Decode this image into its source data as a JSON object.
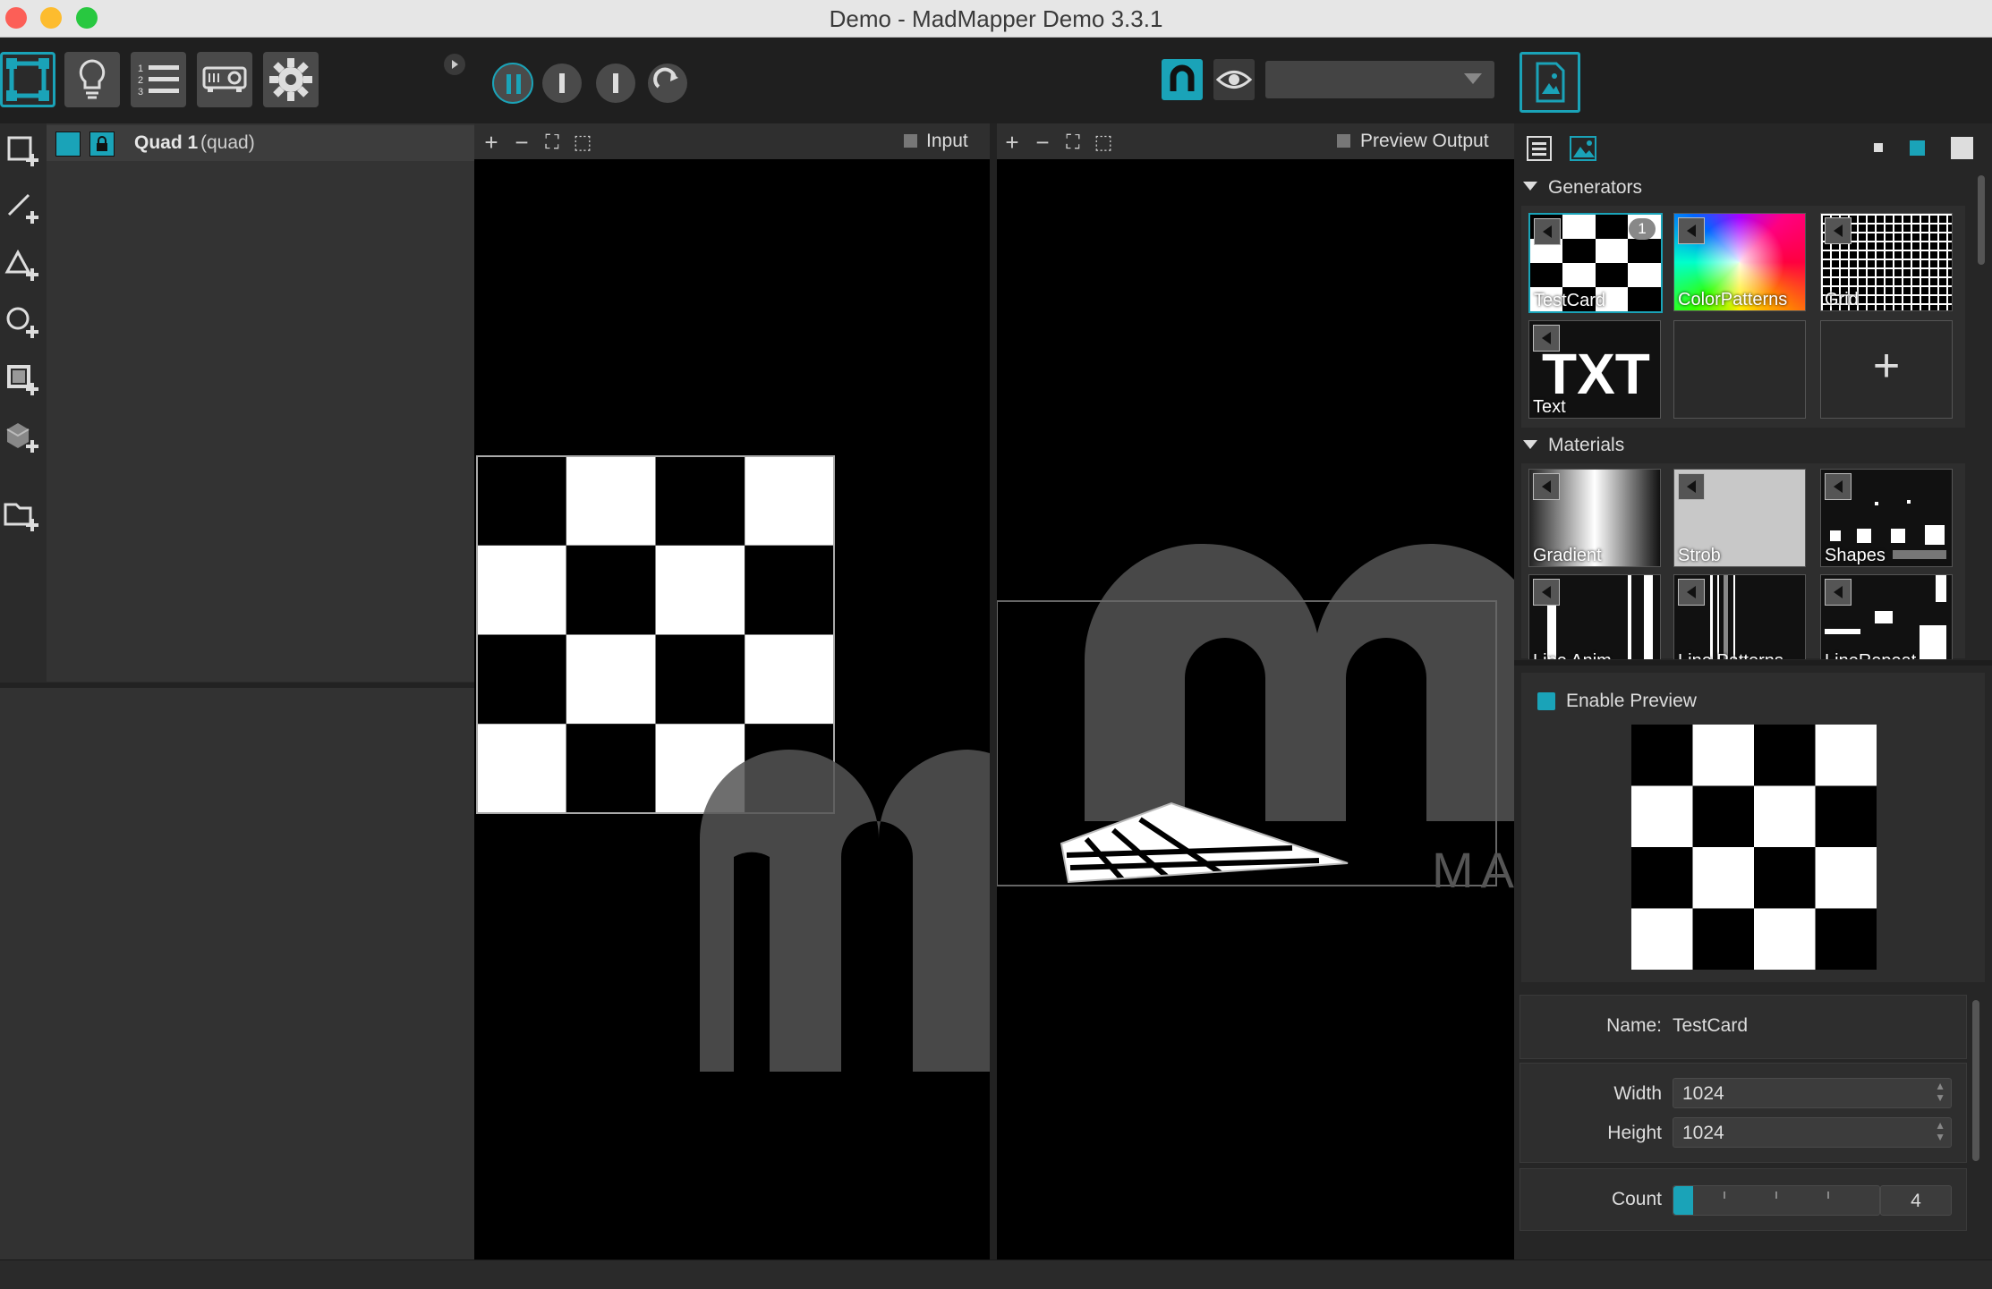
{
  "window": {
    "title": "Demo - MadMapper Demo 3.3.1"
  },
  "toolbar": {
    "left_buttons": [
      "surfaces-icon",
      "lightbulb-icon",
      "cue-list-icon",
      "projector-icon",
      "gear-icon"
    ],
    "transport": [
      "pause-icon",
      "stop-icon",
      "step-icon",
      "loop-icon"
    ],
    "output_selector_value": ""
  },
  "surfaces": {
    "items": [
      {
        "name": "Quad 1",
        "type": "(quad)"
      }
    ]
  },
  "input_view": {
    "label": "Input",
    "controls": [
      "+",
      "−",
      "⛶",
      "⬚"
    ]
  },
  "output_view": {
    "label": "Preview Output",
    "controls": [
      "+",
      "−",
      "⛶",
      "⬚"
    ],
    "watermark_text": "MA"
  },
  "library": {
    "generators_label": "Generators",
    "generators": [
      {
        "label": "TestCard",
        "badge": "1",
        "selected": true
      },
      {
        "label": "ColorPatterns"
      },
      {
        "label": "Grid"
      },
      {
        "label": "Text",
        "icon_text": "TXT"
      }
    ],
    "add_label": "+",
    "materials_label": "Materials",
    "materials": [
      {
        "label": "Gradient"
      },
      {
        "label": "Strob"
      },
      {
        "label": "Shapes"
      },
      {
        "label": "Line Anim"
      },
      {
        "label": "Line Patterns"
      },
      {
        "label": "LineRepeat"
      }
    ]
  },
  "preview": {
    "enable_label": "Enable Preview"
  },
  "properties": {
    "name_label": "Name:",
    "name_value": "TestCard",
    "width_label": "Width",
    "width_value": "1024",
    "height_label": "Height",
    "height_value": "1024",
    "count_label": "Count",
    "count_value": "4"
  },
  "colors": {
    "accent": "#1aa3b8",
    "panel_bg": "#2b2b2b",
    "toolbar_bg": "#1f1f1f"
  }
}
